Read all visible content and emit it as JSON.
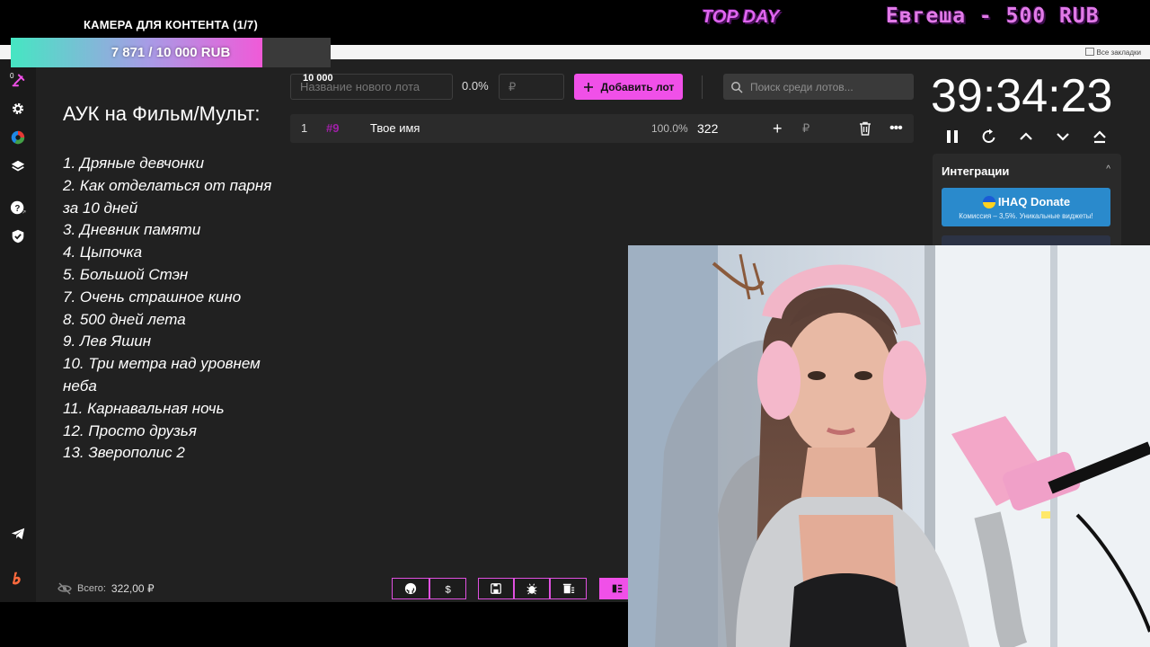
{
  "overlay": {
    "goal_title": "КАМЕРА ДЛЯ КОНТЕНТА (1/7)",
    "goal_progress_text": "7 871 / 10 000 RUB",
    "goal_progress": 0.7871,
    "goal_target": "10 000",
    "top_day_label": "TOP DAY",
    "top_donor": "Евгеша - 500 RUB"
  },
  "browser": {
    "bookmarks_label": "Все закладки"
  },
  "sidebar": {
    "top_marker": "0",
    "items": [
      "auction-icon",
      "gear-icon",
      "pie-chart-icon",
      "layers-icon",
      "help-icon",
      "shield-icon",
      "telegram-icon",
      "brand-logo-icon"
    ]
  },
  "film_list": {
    "title": "АУК на Фильм/Мульт:",
    "items": [
      "1. Дряные девчонки",
      "2. Как отделаться от парня за 10 дней",
      "3. Дневник памяти",
      "4. Цыпочка",
      "5. Большой Стэн",
      "7. Очень страшное кино",
      "8. 500 дней лета",
      "9. Лев Яшин",
      "10. Три метра над уровнем неба",
      "11. Карнавальная ночь",
      "12. Просто друзья",
      "13. Зверополис 2"
    ]
  },
  "toolbar": {
    "lot_name_placeholder": "Название нового лота",
    "percent": "0.0%",
    "currency_symbol": "₽",
    "add_lot_label": "Добавить лот",
    "search_placeholder": "Поиск среди лотов..."
  },
  "lots": [
    {
      "num": "1",
      "id": "#9",
      "name": "Твое имя",
      "percent": "100.0%",
      "amount": "322",
      "currency": "₽"
    }
  ],
  "timer": {
    "value": "39:34:23"
  },
  "integrations": {
    "title": "Интеграции",
    "ihaq_name": "IHAQ Donate",
    "ihaq_description": "Комиссия – 3,5%. Уникальные виджеты!"
  },
  "footer": {
    "total_label": "Всего:",
    "total_value": "322,00 ₽"
  },
  "colors": {
    "accent": "#f050e8",
    "app_bg": "#212121",
    "sidebar_bg": "#1a1a1a",
    "row_bg": "#2b2b2b",
    "ihaq_blue": "#2a8acc"
  }
}
